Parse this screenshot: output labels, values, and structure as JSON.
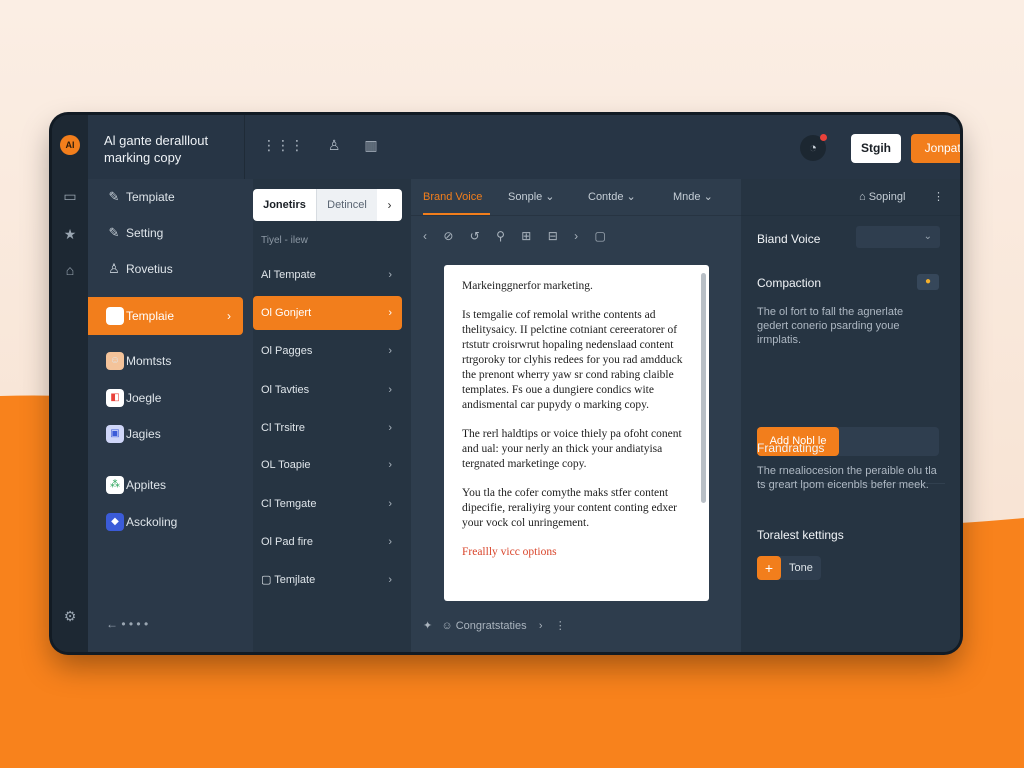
{
  "colors": {
    "accent": "#f27e1c",
    "window_bg": "#243240",
    "paper": "#ffffff",
    "link": "#d9452b"
  },
  "header": {
    "title": "Al gante deralllout marking copy",
    "icons": [
      "grid-icon",
      "user-icon",
      "book-icon"
    ],
    "btn_white": "Stgih",
    "btn_orange": "Jonpate"
  },
  "nav": {
    "items": [
      {
        "label": "Tempiate",
        "icon": "edit-icon"
      },
      {
        "label": "Setting",
        "icon": "edit-icon"
      },
      {
        "label": "Rovetius",
        "icon": "user-icon"
      },
      {
        "label": "Templaie",
        "icon": "app-icon",
        "active": true
      },
      {
        "label": "Momtsts",
        "icon": "avatar-icon"
      },
      {
        "label": "Joegle",
        "icon": "app-icon"
      },
      {
        "label": "Jagies",
        "icon": "app-icon"
      },
      {
        "label": "Appites",
        "icon": "app-icon"
      },
      {
        "label": "Asckoling",
        "icon": "app-icon"
      }
    ],
    "bottom": "← • • • •"
  },
  "list": {
    "seg_a": "Jonetirs",
    "seg_b": "Detincel",
    "caption": "Tiyel - ilew",
    "items": [
      {
        "label": "Al Tempate"
      },
      {
        "label": "Ol Gonjert",
        "active": true
      },
      {
        "label": "Ol Pagges"
      },
      {
        "label": "Ol Tavties"
      },
      {
        "label": "Cl Trsitre"
      },
      {
        "label": "OL Toapie"
      },
      {
        "label": "Cl Temgate"
      },
      {
        "label": "Ol Pad fire"
      },
      {
        "label": "Temjlate"
      }
    ]
  },
  "editor": {
    "tabs": [
      "Brand Voice",
      "Sonple ⌄",
      "Contde ⌄",
      "Mnde ⌄"
    ],
    "paper": {
      "p1": "Markeinggnerfor marketing.",
      "p2": "Is temgalie cof remolal writhe contents ad thelitysaicy. II pelctine cotniant cereeratorer of rtstutr croisrwrut hopaling nedenslaad content rtrgoroky tor clyhis redees for you rad amdduck the prenont wherry yaw sr cond rabing claible templates. Fs oue a dungiere condics wite andismental car pupydy o marking copy.",
      "p3": "The rerl haldtips or voice thiely pa ofoht conent and ual: your nerly an thick your andiatyisa tergnated marketinge copy.",
      "p4": "You tla the cofer comythe maks stfer content dipecifie, reraliyirg your content conting edxer your vock col unringement.",
      "link": "Freallly vicc options"
    },
    "footer": "Congratstaties"
  },
  "right": {
    "header": "Sopingl",
    "brand_voice": "Biand Voice",
    "compaction": "Compaction",
    "compaction_text": "The ol fort to fall the agnerlate gedert conerio psarding youe irmplatis.",
    "add_btn": "Add Nobl le",
    "frandratings": "Frandratings",
    "frandratings_text": "The rnealiocesion the peraible olu tla ts greart lpom eicenbls befer meek.",
    "toralest": "Toralest kettings",
    "tone": "Tone"
  }
}
